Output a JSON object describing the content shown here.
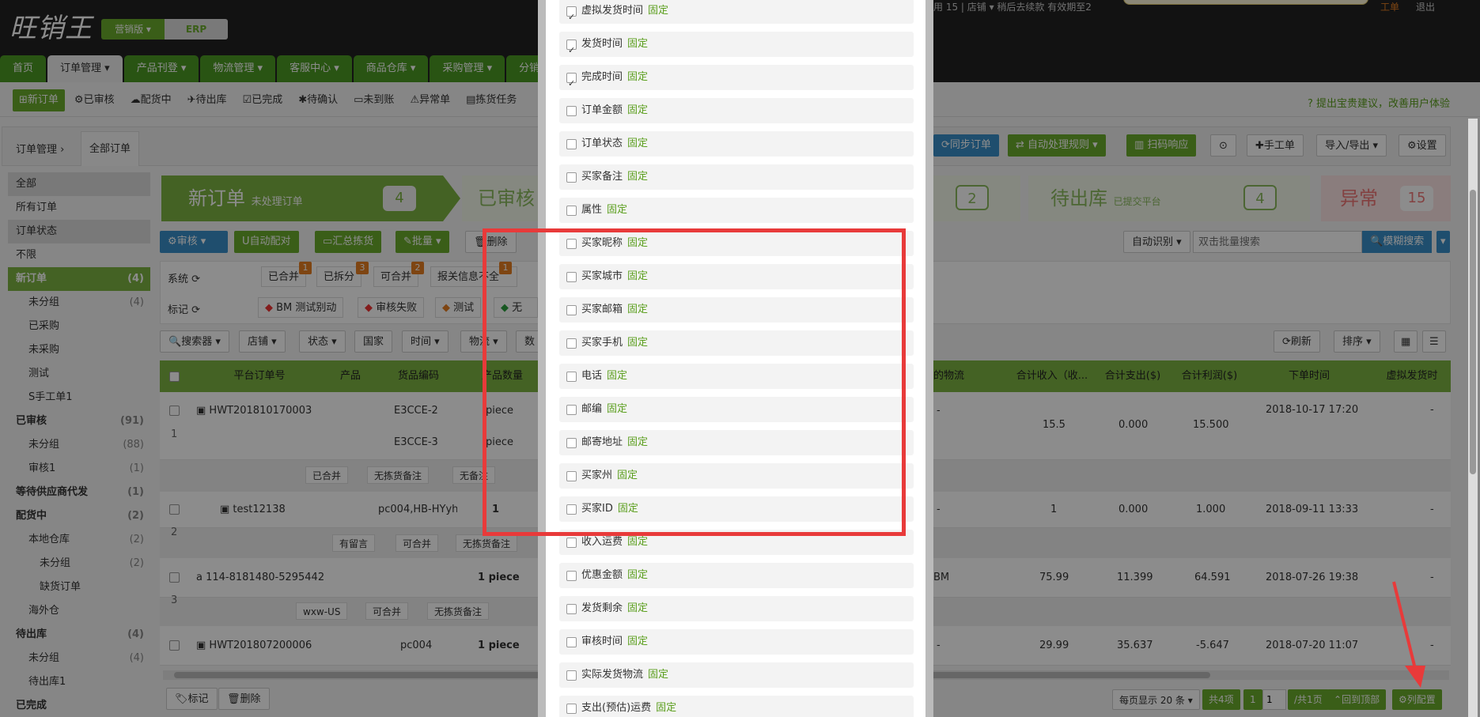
{
  "brand": {
    "logo": "旺销王",
    "edition": "营销版",
    "erp": "ERP"
  },
  "nav": [
    "首页",
    "订单管理",
    "产品刊登",
    "物流管理",
    "客服中心",
    "商品仓库",
    "采购管理",
    "分销"
  ],
  "subnav": [
    "新订单",
    "已审核",
    "配货中",
    "待出库",
    "已完成",
    "待确认",
    "未到账",
    "异常单",
    "拣货任务"
  ],
  "suggest": "提出宝贵建议，改善用户体验",
  "breadcrumb": {
    "root": "订单管理",
    "tab": "全部订单"
  },
  "left_nav": [
    {
      "label": "全部",
      "count": "",
      "type": "hd"
    },
    {
      "label": "所有订单",
      "count": "",
      "type": ""
    },
    {
      "label": "订单状态",
      "count": "",
      "type": "hd"
    },
    {
      "label": "不限",
      "count": "",
      "type": ""
    },
    {
      "label": "新订单",
      "count": "(4)",
      "type": "sel"
    },
    {
      "label": "未分组",
      "count": "(4)",
      "type": "i1"
    },
    {
      "label": "已采购",
      "count": "",
      "type": "i1"
    },
    {
      "label": "未采购",
      "count": "",
      "type": "i1"
    },
    {
      "label": "测试",
      "count": "",
      "type": "i1"
    },
    {
      "label": "S手工单1",
      "count": "",
      "type": "i1"
    },
    {
      "label": "已审核",
      "count": "(91)",
      "type": "b"
    },
    {
      "label": "未分组",
      "count": "(88)",
      "type": "i1"
    },
    {
      "label": "审核1",
      "count": "(1)",
      "type": "i1"
    },
    {
      "label": "等待供应商代发",
      "count": "(1)",
      "type": "b"
    },
    {
      "label": "配货中",
      "count": "(2)",
      "type": "b"
    },
    {
      "label": "本地仓库",
      "count": "(2)",
      "type": "i1"
    },
    {
      "label": "未分组",
      "count": "(2)",
      "type": "i2"
    },
    {
      "label": "缺货订单",
      "count": "",
      "type": "i2"
    },
    {
      "label": "海外仓",
      "count": "",
      "type": "i1"
    },
    {
      "label": "待出库",
      "count": "(4)",
      "type": "b"
    },
    {
      "label": "未分组",
      "count": "(4)",
      "type": "i1"
    },
    {
      "label": "待出库1",
      "count": "",
      "type": "i1"
    },
    {
      "label": "已完成",
      "count": "",
      "type": "b"
    }
  ],
  "stages": {
    "new": {
      "label": "新订单",
      "sub": "未处理订单",
      "count": "4"
    },
    "audited": {
      "label": "已审核"
    },
    "mid_count": "2",
    "out": {
      "label": "待出库",
      "sub": "已提交平台",
      "count": "4"
    },
    "abnormal": {
      "label": "异常",
      "count": "15"
    }
  },
  "toolbar_right": [
    "同步订单",
    "自动处理规则",
    "扫码响应",
    "手工单",
    "导入/导出",
    "设置"
  ],
  "actions": [
    "审核",
    "自动配对",
    "汇总拣货",
    "批量",
    "删除"
  ],
  "search": {
    "mode": "自动识别",
    "placeholder": "双击批量搜索",
    "button": "模糊搜索"
  },
  "filter_system": {
    "label": "系统",
    "tags": [
      "已合并",
      "已拆分",
      "可合并",
      "报关信息不全"
    ],
    "badges": [
      "1",
      "3",
      "2",
      "1"
    ]
  },
  "filter_mark": {
    "label": "标记",
    "tags": [
      "BM 测试别动",
      "审核失败",
      "测试",
      "无标"
    ]
  },
  "filter_bar": [
    "搜索器",
    "店铺",
    "状态",
    "国家",
    "时间",
    "物流",
    "数"
  ],
  "refresh": "刷新",
  "sort": "排序",
  "table_headers_left": [
    "平台订单号",
    "产品",
    "货品编码",
    "产品数量"
  ],
  "table_headers_right": [
    "的物流",
    "合计收入（收...",
    "合计支出($)",
    "合计利润($)",
    "下单时间",
    "虚拟发货时"
  ],
  "rows": [
    {
      "idx": "1",
      "order": "HWT201810170003",
      "skus": [
        "E3CCE-2",
        "E3CCE-3"
      ],
      "qty": [
        "piece",
        "piece"
      ],
      "logistics": "-",
      "income": "15.5",
      "expense": "0.000",
      "profit": "15.500",
      "time": "2018-10-17 17:20",
      "virtual": "-",
      "tags": [
        "已合并",
        "无拣货备注",
        "无备注"
      ]
    },
    {
      "idx": "2",
      "order": "test12138",
      "skus": [
        "pc004,HB-HYyh"
      ],
      "qty": [
        "1"
      ],
      "logistics": "-",
      "income": "1",
      "expense": "0.000",
      "profit": "1.000",
      "time": "2018-09-11 13:33",
      "virtual": "-",
      "tags": [
        "有留言",
        "可合并",
        "无拣货备注"
      ]
    },
    {
      "idx": "3",
      "order": "114-8181480-5295442",
      "skus": [
        ""
      ],
      "qty": [
        "1 piece"
      ],
      "logistics": "BM",
      "income": "75.99",
      "expense": "11.399",
      "profit": "64.591",
      "time": "2018-07-26 19:38",
      "virtual": "-",
      "tags": [
        "wxw-US",
        "可合并",
        "无拣货备注"
      ]
    },
    {
      "idx": "4",
      "order": "HWT201807200006",
      "skus": [
        "pc004"
      ],
      "qty": [
        "1 piece"
      ],
      "logistics": "-",
      "income": "29.99",
      "expense": "35.637",
      "profit": "-5.647",
      "time": "2018-07-20 11:07",
      "virtual": "-",
      "tags": []
    }
  ],
  "bottom_left": [
    "标记",
    "删除"
  ],
  "pager": {
    "per_page": "每页显示 20 条",
    "total": "共4项",
    "page": "1",
    "page_input": "1",
    "pages": "/共1页",
    "top": "回到顶部",
    "config": "列配置"
  },
  "panel_fixed": "固定",
  "panel_items": [
    {
      "label": "虚拟发货时间",
      "checked": true
    },
    {
      "label": "发货时间",
      "checked": true
    },
    {
      "label": "完成时间",
      "checked": true
    },
    {
      "label": "订单金额",
      "checked": false
    },
    {
      "label": "订单状态",
      "checked": false
    },
    {
      "label": "买家备注",
      "checked": false
    },
    {
      "label": "属性",
      "checked": false
    },
    {
      "label": "买家昵称",
      "checked": false
    },
    {
      "label": "买家城市",
      "checked": false
    },
    {
      "label": "买家邮箱",
      "checked": false
    },
    {
      "label": "买家手机",
      "checked": false
    },
    {
      "label": "电话",
      "checked": false
    },
    {
      "label": "邮编",
      "checked": false
    },
    {
      "label": "邮寄地址",
      "checked": false
    },
    {
      "label": "买家州",
      "checked": false
    },
    {
      "label": "买家ID",
      "checked": false
    },
    {
      "label": "收入运费",
      "checked": false
    },
    {
      "label": "优惠金额",
      "checked": false
    },
    {
      "label": "发货剩余",
      "checked": false
    },
    {
      "label": "审核时间",
      "checked": false
    },
    {
      "label": "实际发货物流",
      "checked": false
    },
    {
      "label": "支出(预估)运费",
      "checked": false
    }
  ],
  "top_right_text": {
    "a": "用 15 | 店铺",
    "b": "稍后去续款 有效期至2",
    "c": "工单",
    "d": "退出"
  },
  "colors": {
    "green": "#6aab2c",
    "dark": "#222222",
    "red_box": "#e83a3a",
    "blue": "#3a8fc8",
    "orange": "#e67e22"
  }
}
